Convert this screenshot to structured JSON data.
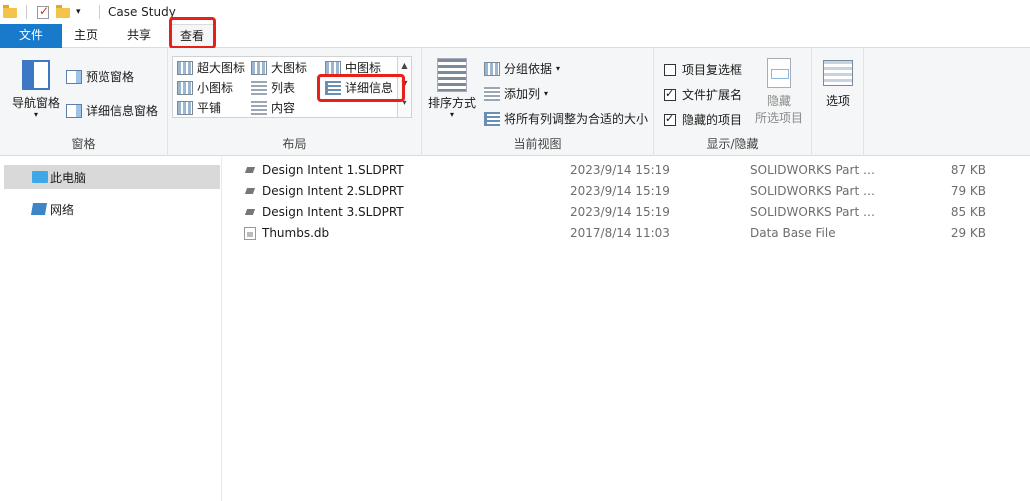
{
  "window": {
    "title": "Case Study"
  },
  "tabs": {
    "file": "文件",
    "home": "主页",
    "share": "共享",
    "view": "查看"
  },
  "ribbon": {
    "panes": {
      "label": "窗格",
      "nav_pane": "导航窗格",
      "preview_pane": "预览窗格",
      "details_pane": "详细信息窗格"
    },
    "layout": {
      "label": "布局",
      "extra_large_icons": "超大图标",
      "large_icons": "大图标",
      "medium_icons": "中图标",
      "small_icons": "小图标",
      "list": "列表",
      "details": "详细信息",
      "tiles": "平铺",
      "content": "内容"
    },
    "current_view": {
      "label": "当前视图",
      "sort_by": "排序方式",
      "group_by": "分组依据",
      "add_columns": "添加列",
      "size_all_columns": "将所有列调整为合适的大小"
    },
    "show_hide": {
      "label": "显示/隐藏",
      "item_checkboxes": "项目复选框",
      "item_checkboxes_checked": false,
      "file_extensions": "文件扩展名",
      "file_extensions_checked": true,
      "hidden_items": "隐藏的项目",
      "hidden_items_checked": true,
      "hide_selected_line1": "隐藏",
      "hide_selected_line2": "所选项目"
    },
    "options": {
      "label": "选项"
    }
  },
  "nav": {
    "items": [
      {
        "label": "此电脑",
        "selected": true
      },
      {
        "label": "网络",
        "selected": false
      }
    ]
  },
  "files": [
    {
      "name": "Design Intent 1.SLDPRT",
      "date": "2023/9/14 15:19",
      "type": "SOLIDWORKS Part D...",
      "size": "87 KB",
      "icon": "sldprt-icon"
    },
    {
      "name": "Design Intent 2.SLDPRT",
      "date": "2023/9/14 15:19",
      "type": "SOLIDWORKS Part D...",
      "size": "79 KB",
      "icon": "sldprt-icon"
    },
    {
      "name": "Design Intent 3.SLDPRT",
      "date": "2023/9/14 15:19",
      "type": "SOLIDWORKS Part D...",
      "size": "85 KB",
      "icon": "sldprt-icon"
    },
    {
      "name": "Thumbs.db",
      "date": "2017/8/14 11:03",
      "type": "Data Base File",
      "size": "29 KB",
      "icon": "db-file-icon"
    }
  ],
  "colors": {
    "file_tab": "#1979ca",
    "highlight": "#e8201b",
    "selected_nav": "#d9d9d9"
  }
}
